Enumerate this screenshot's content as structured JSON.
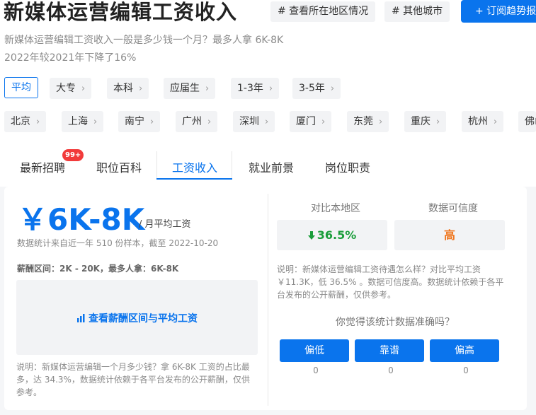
{
  "header": {
    "title": "新媒体运营编辑工资收入",
    "tag_region": "# 查看所在地区情况",
    "tag_city": "# 其他城市",
    "subscribe": "+ 订阅趋势报告"
  },
  "summary": {
    "line1": "新媒体运营编辑工资收入一般是多少钱一个月？最多人拿 6K-8K",
    "line2": "2022年较2021年下降了16%"
  },
  "filters": {
    "edu": [
      "平均",
      "大专",
      "本科",
      "应届生",
      "1-3年",
      "3-5年"
    ],
    "cities": [
      "北京",
      "上海",
      "南宁",
      "广州",
      "深圳",
      "厦门",
      "东莞",
      "重庆",
      "杭州",
      "佛山"
    ]
  },
  "tabs": {
    "items": [
      "最新招聘",
      "职位百科",
      "工资收入",
      "就业前景",
      "岗位职责"
    ],
    "badge": "99+"
  },
  "salary": {
    "value": "￥6K-8K",
    "unit": "/ 月平均工资",
    "stat": "数据统计来自近一年 510 份样本，截至 2022-10-20",
    "range": "薪酬区间：2K - 20K，最多人拿：6K-8K",
    "range_link": "查看薪酬区间与平均工资",
    "note": "说明：新媒体运营编辑一个月多少钱？拿 6K-8K 工资的占比最多，达 34.3%，数据统计依赖于各平台发布的公开薪酬，仅供参考。"
  },
  "compare": {
    "h_local": "对比本地区",
    "h_trust": "数据可信度",
    "local_value": "36.5%",
    "trust_value": "高",
    "note": "说明：新媒体运营编辑工资待遇怎么样？对比平均工资 ￥11.3K，低 36.5% 。数据可信度高。数据统计依赖于各平台发布的公开薪酬，仅供参考。",
    "question": "你觉得该统计数据准确吗？",
    "votes": [
      {
        "label": "偏低",
        "count": "0"
      },
      {
        "label": "靠谱",
        "count": "0"
      },
      {
        "label": "偏高",
        "count": "0"
      }
    ]
  },
  "colors": {
    "accent": "#0a74ed",
    "down": "#1a9d3a",
    "high": "#f0761e",
    "badge": "#f23b3b"
  }
}
